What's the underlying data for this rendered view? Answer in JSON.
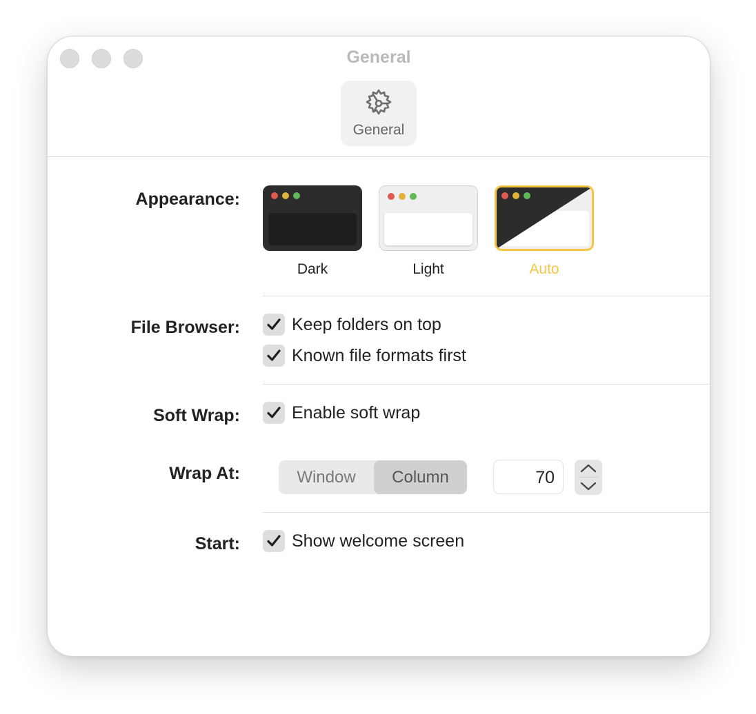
{
  "window": {
    "title": "General"
  },
  "toolbar": {
    "tab_label": "General",
    "tab_icon": "gear-icon"
  },
  "appearance": {
    "label": "Appearance:",
    "options": [
      {
        "label": "Dark",
        "selected": false
      },
      {
        "label": "Light",
        "selected": false
      },
      {
        "label": "Auto",
        "selected": true
      }
    ],
    "selected_color": "#f5c645"
  },
  "file_browser": {
    "label": "File Browser:",
    "options": [
      {
        "label": "Keep folders on top",
        "checked": true
      },
      {
        "label": "Known file formats first",
        "checked": true
      }
    ]
  },
  "soft_wrap": {
    "label": "Soft Wrap:",
    "option": {
      "label": "Enable soft wrap",
      "checked": true
    }
  },
  "wrap_at": {
    "label": "Wrap At:",
    "segments": [
      "Window",
      "Column"
    ],
    "selected_segment": "Column",
    "column_value": "70"
  },
  "start": {
    "label": "Start:",
    "option": {
      "label": "Show welcome screen",
      "checked": true
    }
  }
}
